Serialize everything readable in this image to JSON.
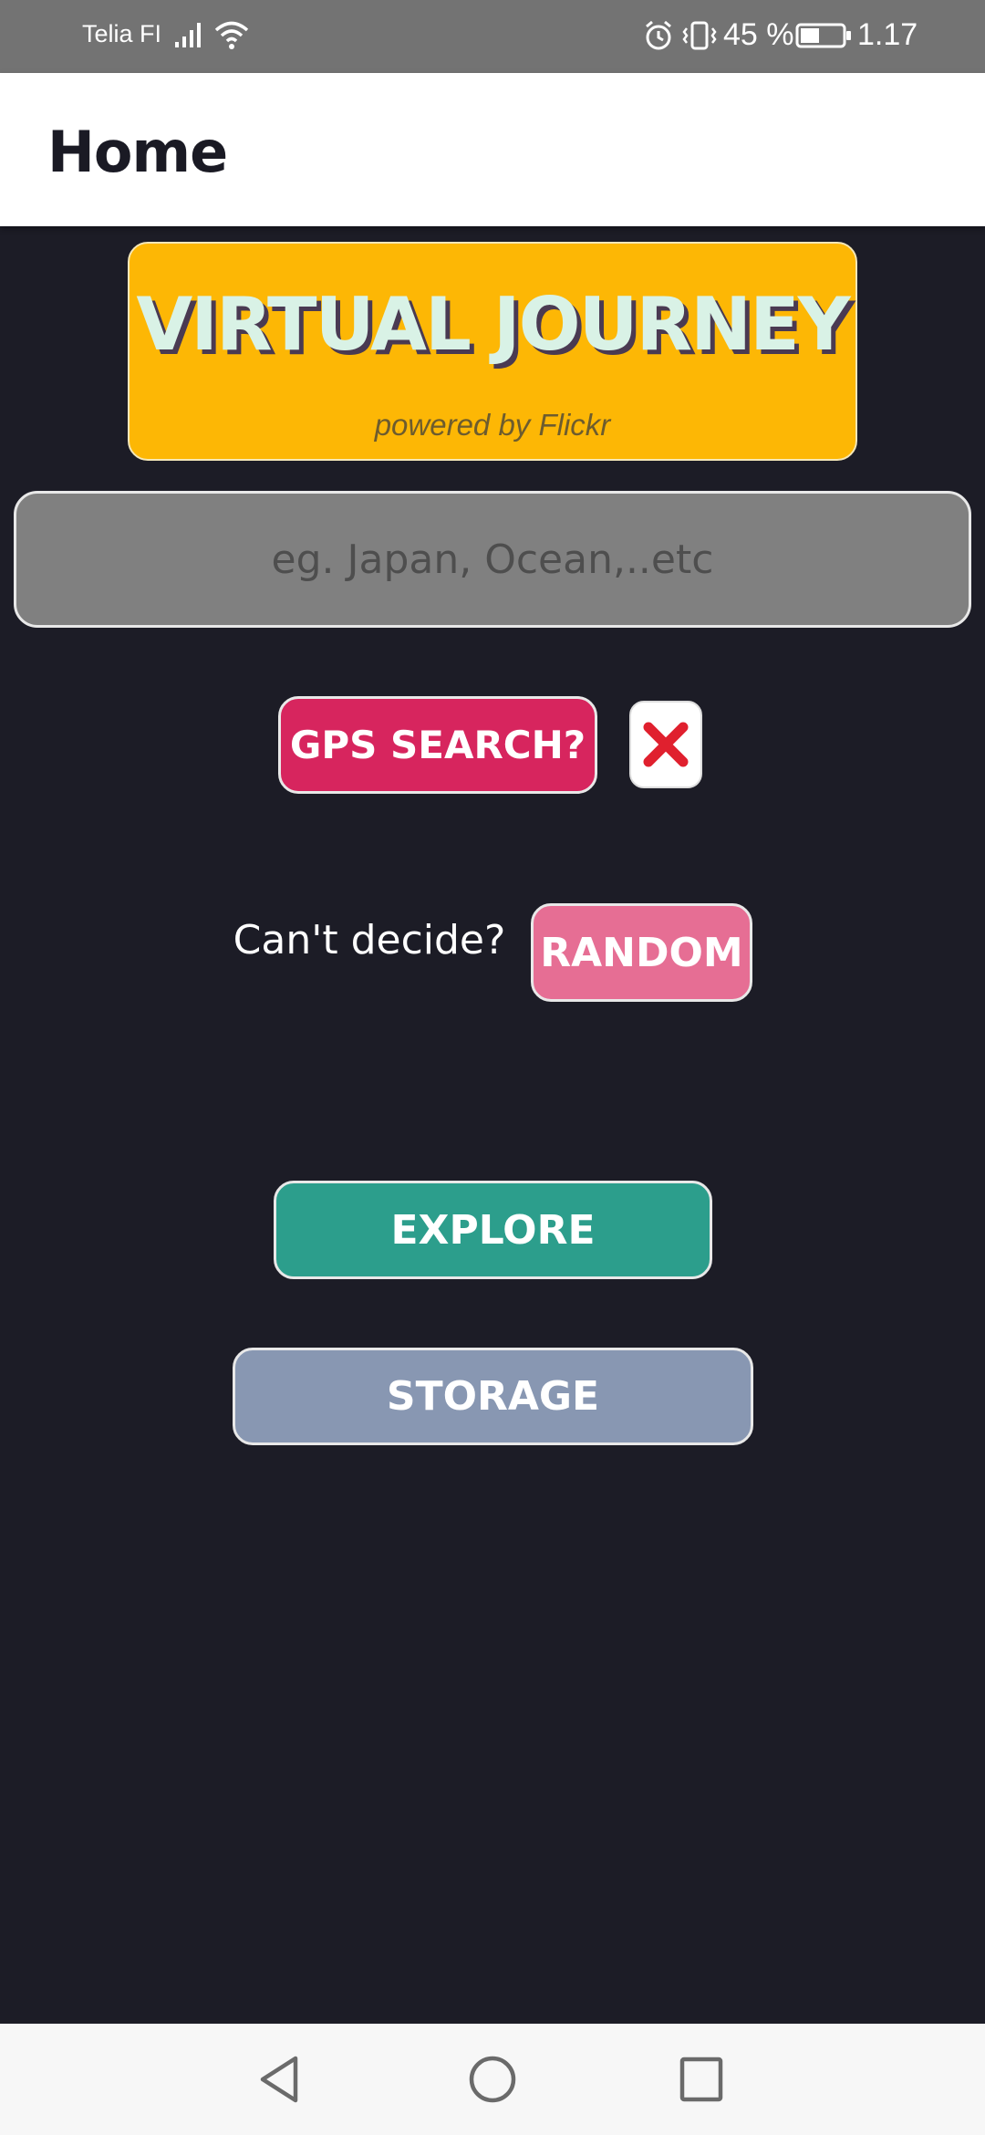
{
  "status_bar": {
    "carrier": "Telia FI",
    "battery_percent": "45 %",
    "battery_level": 0.45,
    "time": "1.17",
    "icons": [
      "signal-icon",
      "wifi-icon",
      "alarm-icon",
      "vibrate-icon",
      "battery-icon"
    ]
  },
  "app_bar": {
    "title": "Home"
  },
  "banner": {
    "title": "VIRTUAL JOURNEY",
    "subtitle": "powered by Flickr"
  },
  "search": {
    "value": "",
    "placeholder": "eg. Japan, Ocean,..etc"
  },
  "gps": {
    "button_label": "GPS SEARCH?",
    "clear_icon": "close-icon",
    "clear_color": "#e0202e"
  },
  "random": {
    "prompt": "Can't decide?",
    "button_label": "RANDOM"
  },
  "actions": {
    "explore_label": "EXPLORE",
    "storage_label": "STORAGE"
  },
  "nav_bar": {
    "icons": [
      "back-icon",
      "home-icon",
      "recents-icon"
    ]
  },
  "colors": {
    "background": "#1c1c26",
    "banner": "#fdb705",
    "gps_button": "#d7255e",
    "random_button": "#e66e94",
    "explore_button": "#2c9e8c",
    "storage_button": "#8897b2",
    "search_field": "#808080"
  }
}
